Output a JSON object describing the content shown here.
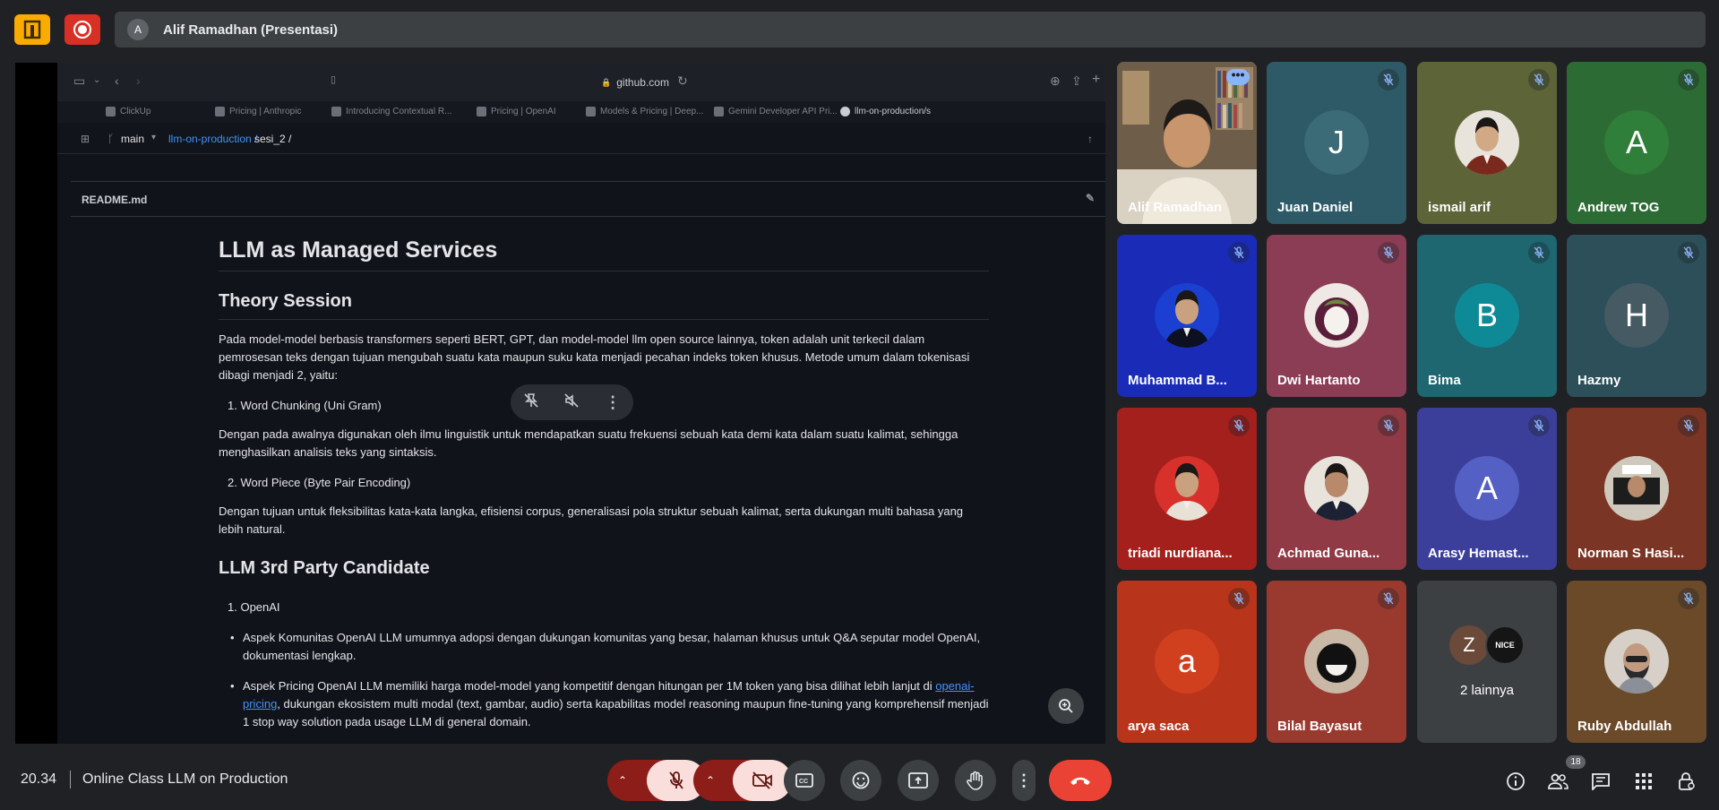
{
  "presenter": {
    "avatar_letter": "A",
    "label": "Alif Ramadhan (Presentasi)"
  },
  "browser": {
    "url": "github.com",
    "tabs": [
      "ClickUp",
      "Pricing | Anthropic",
      "Introducing Contextual R...",
      "Pricing | OpenAI",
      "Models & Pricing | Deep...",
      "Gemini Developer API Pri...",
      "llm-on-production/s"
    ],
    "branch": "main",
    "repo": "llm-on-production /",
    "folder": "sesi_2 /",
    "file": "README.md"
  },
  "doc": {
    "h1": "LLM as Managed Services",
    "h2a": "Theory Session",
    "p1": "Pada model-model berbasis transformers seperti BERT, GPT, dan model-model llm open source lainnya, token adalah unit terkecil dalam pemrosesan teks dengan tujuan mengubah suatu kata maupun suku kata menjadi pecahan indeks token khusus. Metode umum dalam tokenisasi dibagi menjadi 2, yaitu:",
    "li1": "1.  Word Chunking (Uni Gram)",
    "p2": "Dengan pada awalnya digunakan oleh ilmu linguistik untuk mendapatkan suatu frekuensi sebuah kata demi kata dalam suatu kalimat, sehingga menghasilkan analisis teks yang sintaksis.",
    "li2": "2.  Word Piece (Byte Pair Encoding)",
    "p3": "Dengan tujuan untuk fleksibilitas kata-kata langka, efisiensi corpus, generalisasi pola struktur sebuah kalimat, serta dukungan multi bahasa yang lebih natural.",
    "h2b": "LLM 3rd Party Candidate",
    "li3": "1.  OpenAI",
    "b1": "Aspek Komunitas OpenAI LLM umumnya adopsi dengan dukungan komunitas yang besar, halaman khusus untuk Q&A seputar model OpenAI, dokumentasi lengkap.",
    "b2a": "Aspek Pricing OpenAI LLM memiliki harga model-model yang kompetitif dengan hitungan per 1M token yang bisa dilihat lebih lanjut di ",
    "b2link": "openai-pricing",
    "b2b": ", dukungan ekosistem multi modal (text, gambar, audio) serta kapabilitas model reasoning maupun fine-tuning yang komprehensif menjadi 1 stop way solution pada usage LLM di general domain."
  },
  "participants": [
    {
      "name": "Alif Ramadhan",
      "bg": "#5d5448",
      "muted": false,
      "kind": "photo"
    },
    {
      "name": "Juan Daniel",
      "bg": "#2d5a66",
      "muted": true,
      "kind": "letter",
      "letter": "J",
      "avbg": "#3b6b76"
    },
    {
      "name": "ismail arif",
      "bg": "#5c6438",
      "muted": true,
      "kind": "photo"
    },
    {
      "name": "Andrew TOG",
      "bg": "#2d6b34",
      "muted": true,
      "kind": "letter",
      "letter": "A",
      "avbg": "#2f7e39"
    },
    {
      "name": "Muhammad B...",
      "bg": "#1a2bb8",
      "muted": true,
      "kind": "photo"
    },
    {
      "name": "Dwi Hartanto",
      "bg": "#8a3d55",
      "muted": true,
      "kind": "photo"
    },
    {
      "name": "Bima",
      "bg": "#1e6670",
      "muted": true,
      "kind": "letter",
      "letter": "B",
      "avbg": "#0e8a97"
    },
    {
      "name": "Hazmy",
      "bg": "#2c4f5a",
      "muted": true,
      "kind": "letter",
      "letter": "H",
      "avbg": "#465a64"
    },
    {
      "name": "triadi nurdiana...",
      "bg": "#a3201c",
      "muted": true,
      "kind": "photo"
    },
    {
      "name": "Achmad Guna...",
      "bg": "#8f3a45",
      "muted": true,
      "kind": "photo"
    },
    {
      "name": "Arasy Hemast...",
      "bg": "#3b3f9a",
      "muted": true,
      "kind": "letter",
      "letter": "A",
      "avbg": "#5560c4"
    },
    {
      "name": "Norman S Hasi...",
      "bg": "#7a3524",
      "muted": true,
      "kind": "photo"
    },
    {
      "name": "arya saca",
      "bg": "#b8341a",
      "muted": true,
      "kind": "letter",
      "letter": "a",
      "avbg": "#d0401f"
    },
    {
      "name": "Bilal Bayasut",
      "bg": "#9a3a2f",
      "muted": true,
      "kind": "photo"
    },
    {
      "name": "2 lainnya",
      "bg": "#3c4043",
      "muted": false,
      "kind": "others",
      "l1": "Z",
      "l2": "NICE"
    },
    {
      "name": "Ruby Abdullah",
      "bg": "#6b4a2a",
      "muted": true,
      "kind": "photo"
    }
  ],
  "meeting": {
    "time": "20.34",
    "title": "Online Class LLM on Production",
    "people_count": "18"
  },
  "colors": {
    "hangup": "#ea4335",
    "muted_btn": "#f9dedc",
    "dark_red": "#8c1d18",
    "bar_bg": "#202124"
  }
}
